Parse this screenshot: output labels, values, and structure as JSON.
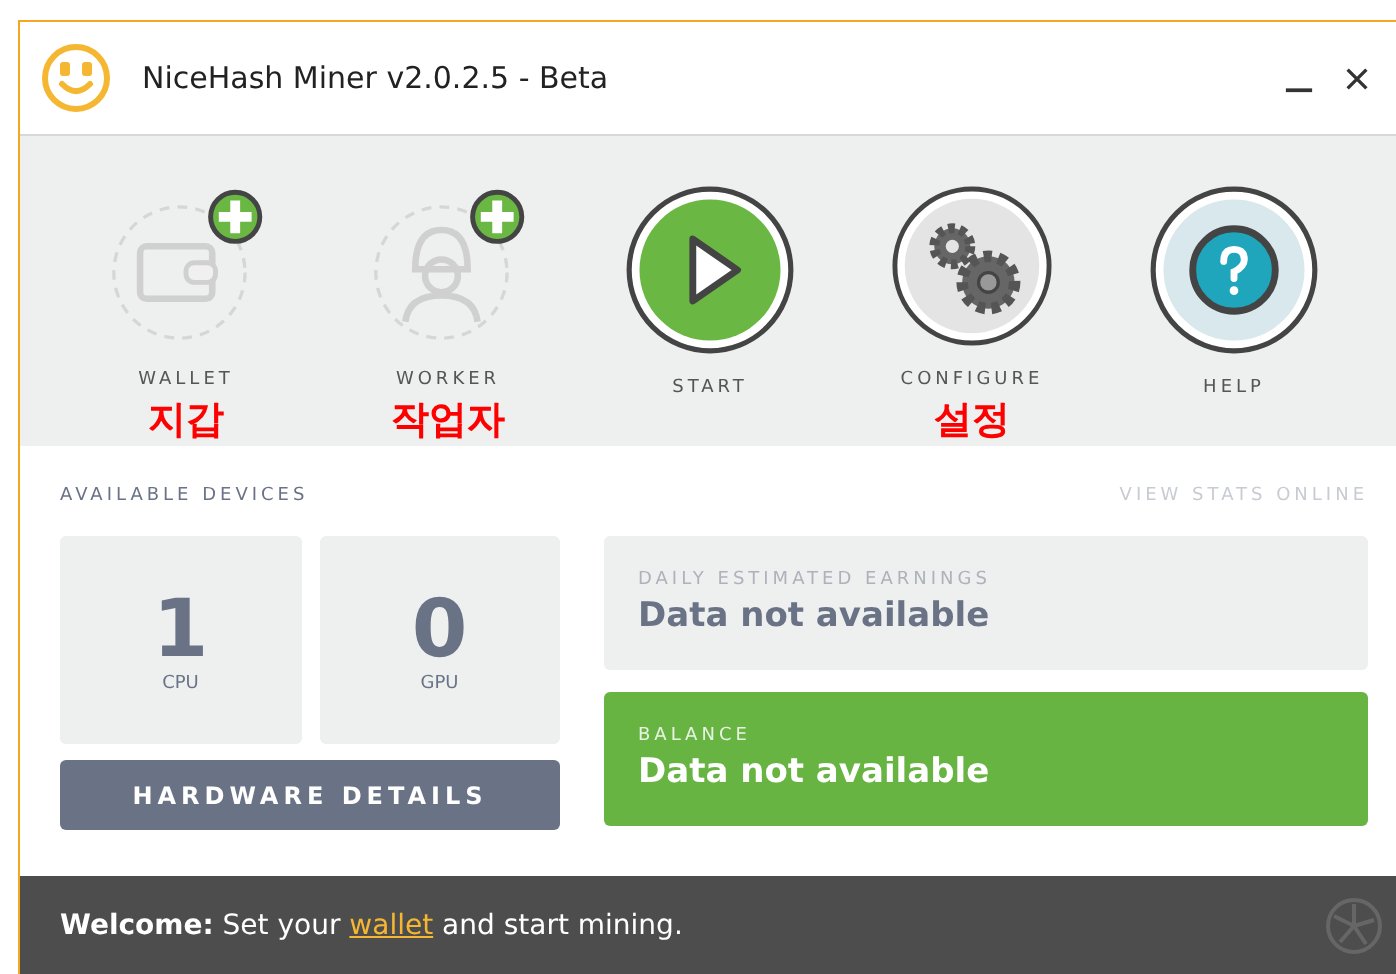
{
  "window": {
    "title": "NiceHash Miner v2.0.2.5 - Beta"
  },
  "toolbar": [
    {
      "kind": "wallet",
      "label": "WALLET",
      "disabled": true,
      "note": "지갑"
    },
    {
      "kind": "worker",
      "label": "WORKER",
      "disabled": true,
      "note": "작업자"
    },
    {
      "kind": "start",
      "label": "START",
      "disabled": false
    },
    {
      "kind": "configure",
      "label": "CONFIGURE",
      "disabled": false,
      "note": "설정"
    },
    {
      "kind": "help",
      "label": "HELP",
      "disabled": false
    }
  ],
  "devices": {
    "title": "AVAILABLE DEVICES",
    "link": "VIEW STATS ONLINE",
    "counts": [
      {
        "value": "1",
        "label": "CPU"
      },
      {
        "value": "0",
        "label": "GPU"
      }
    ],
    "button": "HARDWARE DETAILS"
  },
  "cards": [
    {
      "kind": "earnings",
      "label": "DAILY ESTIMATED EARNINGS",
      "value": "Data not available"
    },
    {
      "kind": "balance",
      "label": "BALANCE",
      "value": "Data not available"
    }
  ],
  "status_bar": {
    "lead": "Welcome:",
    "before": "Set your",
    "link": "wallet",
    "after": "and start mining."
  }
}
